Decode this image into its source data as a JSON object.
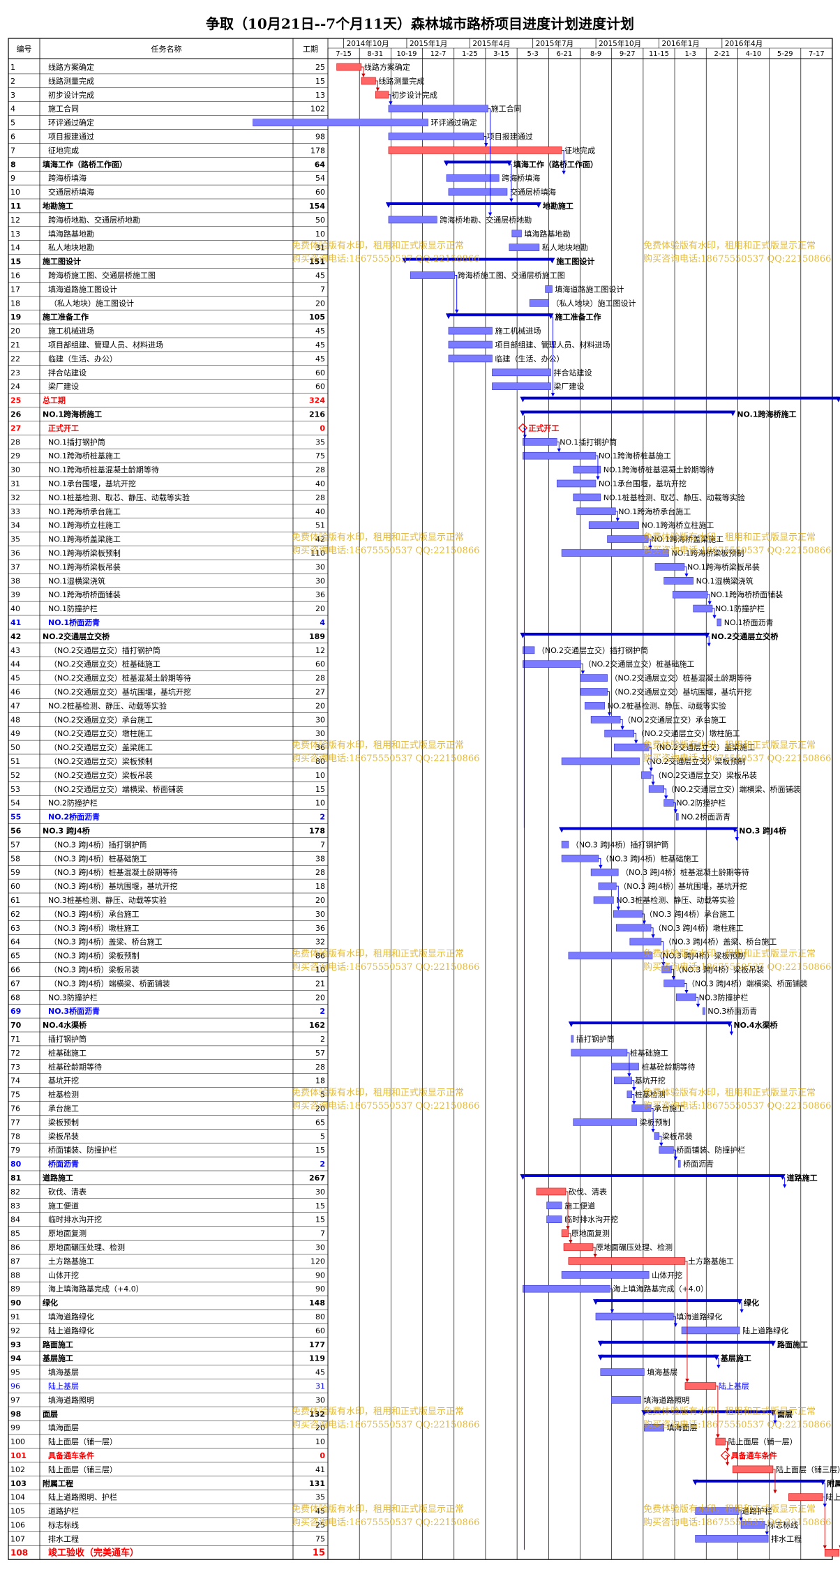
{
  "title": "争取（10月21日--7个月11天）森林城市路桥项目进度计划进度计划",
  "headers": {
    "id": "编号",
    "name": "任务名称",
    "duration": "工期"
  },
  "timescale": {
    "top": [
      "2014年10月",
      "2015年1月",
      "2015年4月",
      "2015年7月",
      "2015年10月",
      "2016年1月",
      "2016年4月"
    ],
    "bottom": [
      "7-15",
      "8-31",
      "10-19",
      "12-7",
      "1-25",
      "3-15",
      "5-3",
      "6-21",
      "8-9",
      "9-27",
      "11-15",
      "1-3",
      "2-21",
      "4-10",
      "5-29",
      "7-17"
    ]
  },
  "watermark": {
    "line1": "免费体验版有水印，租用和正式版显示正常",
    "line2": "购买咨询电话:18675550537 QQ:22150866"
  },
  "colors": {
    "normal_bar": "#7b7bff",
    "critical_bar": "#ff6666",
    "summary": "#0000cc",
    "critical_text": "#ff0000",
    "blue_text": "#0000ff",
    "link_normal": "#0000ff",
    "link_critical": "#cc0000"
  },
  "chart_data": {
    "type": "gantt",
    "x_unit": "week",
    "tasks": [
      {
        "id": 1,
        "name": "线路方案确定",
        "duration": 25,
        "start": 1.3,
        "end": 4.9,
        "style": "c"
      },
      {
        "id": 2,
        "name": "线路测量完成",
        "duration": 15,
        "start": 4.9,
        "end": 7.0,
        "style": "c"
      },
      {
        "id": 3,
        "name": "初步设计完成",
        "duration": 13,
        "start": 7.0,
        "end": 8.9,
        "style": "c"
      },
      {
        "id": 4,
        "name": "施工合同",
        "duration": 102,
        "start": 8.9,
        "end": 23.5,
        "style": "n"
      },
      {
        "id": 5,
        "name": "环评通过确定",
        "duration": 180,
        "start": -11.0,
        "end": 14.7,
        "style": "n"
      },
      {
        "id": 6,
        "name": "项目报建通过",
        "duration": 98,
        "start": 8.9,
        "end": 22.9,
        "style": "n"
      },
      {
        "id": 7,
        "name": "征地完成",
        "duration": 178,
        "start": 8.9,
        "end": 34.3,
        "style": "c"
      },
      {
        "id": 8,
        "name": "填海工作（路桥工作面）",
        "duration": 64,
        "start": 17.4,
        "end": 26.6,
        "style": "s"
      },
      {
        "id": 9,
        "name": "跨海桥填海",
        "duration": 54,
        "start": 17.4,
        "end": 25.1,
        "style": "n"
      },
      {
        "id": 10,
        "name": "交通层桥填海",
        "duration": 60,
        "start": 17.7,
        "end": 26.3,
        "style": "n"
      },
      {
        "id": 11,
        "name": "地勘施工",
        "duration": 154,
        "start": 8.9,
        "end": 30.9,
        "style": "s"
      },
      {
        "id": 12,
        "name": "跨海桥地勘、交通层桥地勘",
        "duration": 50,
        "start": 8.9,
        "end": 16.0,
        "style": "n"
      },
      {
        "id": 13,
        "name": "填海路基地勘",
        "duration": 10,
        "start": 27.0,
        "end": 28.4,
        "style": "n"
      },
      {
        "id": 14,
        "name": "私人地块地勘",
        "duration": 31,
        "start": 26.6,
        "end": 31.0,
        "style": "n"
      },
      {
        "id": 15,
        "name": "施工图设计",
        "duration": 151,
        "start": 11.3,
        "end": 32.9,
        "style": "s"
      },
      {
        "id": 16,
        "name": "跨海桥施工图、交通层桥施工图",
        "duration": 45,
        "start": 12.1,
        "end": 18.6,
        "style": "n"
      },
      {
        "id": 17,
        "name": "填海道路施工图设计",
        "duration": 7,
        "start": 31.9,
        "end": 32.9,
        "style": "n"
      },
      {
        "id": 18,
        "name": "（私人地块）施工图设计",
        "duration": 20,
        "start": 29.6,
        "end": 32.4,
        "style": "n"
      },
      {
        "id": 19,
        "name": "施工准备工作",
        "duration": 105,
        "start": 17.7,
        "end": 32.7,
        "style": "s"
      },
      {
        "id": 20,
        "name": "施工机械进场",
        "duration": 45,
        "start": 17.7,
        "end": 24.1,
        "style": "n"
      },
      {
        "id": 21,
        "name": "项目部组建、管理人员、材料进场",
        "duration": 45,
        "start": 17.7,
        "end": 24.1,
        "style": "n"
      },
      {
        "id": 22,
        "name": "临建（生活、办公）",
        "duration": 45,
        "start": 17.7,
        "end": 24.1,
        "style": "n"
      },
      {
        "id": 23,
        "name": "拌合站建设",
        "duration": 60,
        "start": 24.1,
        "end": 32.7,
        "style": "n"
      },
      {
        "id": 24,
        "name": "梁厂建设",
        "duration": 60,
        "start": 24.1,
        "end": 32.7,
        "style": "n"
      },
      {
        "id": 25,
        "name": "总工期",
        "duration": 324,
        "start": 28.6,
        "end": 74.9,
        "style": "cs"
      },
      {
        "id": 26,
        "name": "NO.1跨海桥施工",
        "duration": 216,
        "start": 28.6,
        "end": 59.4,
        "style": "s"
      },
      {
        "id": 27,
        "name": "正式开工",
        "duration": 0,
        "start": 28.6,
        "end": 28.6,
        "style": "m"
      },
      {
        "id": 28,
        "name": "NO.1插打钢护筒",
        "duration": 35,
        "start": 28.6,
        "end": 33.6,
        "style": "n"
      },
      {
        "id": 29,
        "name": "NO.1跨海桥桩基施工",
        "duration": 75,
        "start": 28.6,
        "end": 39.3,
        "style": "n"
      },
      {
        "id": 30,
        "name": "NO.1跨海桥桩基混凝土龄期等待",
        "duration": 28,
        "start": 36.0,
        "end": 40.0,
        "style": "n"
      },
      {
        "id": 31,
        "name": "NO.1承台围堰，基坑开挖",
        "duration": 40,
        "start": 33.6,
        "end": 39.3,
        "style": "n"
      },
      {
        "id": 32,
        "name": "NO.1桩基检测、取芯、静压、动载等实验",
        "duration": 28,
        "start": 36.0,
        "end": 40.0,
        "style": "n"
      },
      {
        "id": 33,
        "name": "NO.1跨海桥承台施工",
        "duration": 40,
        "start": 36.5,
        "end": 42.2,
        "style": "n"
      },
      {
        "id": 34,
        "name": "NO.1跨海桥立柱施工",
        "duration": 51,
        "start": 38.3,
        "end": 45.6,
        "style": "n"
      },
      {
        "id": 35,
        "name": "NO.1跨海桥盖梁施工",
        "duration": 42,
        "start": 41.0,
        "end": 47.0,
        "style": "n"
      },
      {
        "id": 36,
        "name": "NO.1跨海桥梁板预制",
        "duration": 110,
        "start": 34.3,
        "end": 50.0,
        "style": "n"
      },
      {
        "id": 37,
        "name": "NO.1跨海桥梁板吊装",
        "duration": 30,
        "start": 48.0,
        "end": 52.3,
        "style": "n"
      },
      {
        "id": 38,
        "name": "NO.1湿横梁浇筑",
        "duration": 30,
        "start": 49.3,
        "end": 53.6,
        "style": "n"
      },
      {
        "id": 39,
        "name": "NO.1跨海桥桥面铺装",
        "duration": 36,
        "start": 50.6,
        "end": 55.7,
        "style": "n"
      },
      {
        "id": 40,
        "name": "NO.1防撞护栏",
        "duration": 20,
        "start": 53.6,
        "end": 56.4,
        "style": "n"
      },
      {
        "id": 41,
        "name": "NO.1桥面沥青",
        "duration": 4,
        "start": 57.1,
        "end": 57.7,
        "style": "n"
      },
      {
        "id": 42,
        "name": "NO.2交通层立交桥",
        "duration": 189,
        "start": 28.6,
        "end": 55.6,
        "style": "s"
      },
      {
        "id": 43,
        "name": "（NO.2交通层立交）插打钢护筒",
        "duration": 12,
        "start": 28.6,
        "end": 30.3,
        "style": "n"
      },
      {
        "id": 44,
        "name": "（NO.2交通层立交）桩基础施工",
        "duration": 60,
        "start": 28.6,
        "end": 37.1,
        "style": "n"
      },
      {
        "id": 45,
        "name": "（NO.2交通层立交）桩基混凝土龄期等待",
        "duration": 28,
        "start": 37.0,
        "end": 41.0,
        "style": "n"
      },
      {
        "id": 46,
        "name": "（NO.2交通层立交）基坑围堰，基坑开挖",
        "duration": 27,
        "start": 37.1,
        "end": 41.0,
        "style": "n"
      },
      {
        "id": 47,
        "name": "NO.2桩基检测、静压、动载等实验",
        "duration": 20,
        "start": 37.7,
        "end": 40.6,
        "style": "n"
      },
      {
        "id": 48,
        "name": "（NO.2交通层立交）承台施工",
        "duration": 30,
        "start": 38.6,
        "end": 42.9,
        "style": "n"
      },
      {
        "id": 49,
        "name": "（NO.2交通层立交）墩柱施工",
        "duration": 30,
        "start": 40.6,
        "end": 44.9,
        "style": "n"
      },
      {
        "id": 50,
        "name": "（NO.2交通层立交）盖梁施工",
        "duration": 36,
        "start": 42.0,
        "end": 47.1,
        "style": "n"
      },
      {
        "id": 51,
        "name": "（NO.2交通层立交）梁板预制",
        "duration": 80,
        "start": 34.3,
        "end": 45.7,
        "style": "n"
      },
      {
        "id": 52,
        "name": "（NO.2交通层立交）梁板吊装",
        "duration": 10,
        "start": 46.0,
        "end": 47.4,
        "style": "n"
      },
      {
        "id": 53,
        "name": "（NO.2交通层立交）端横梁、桥面铺装",
        "duration": 15,
        "start": 47.1,
        "end": 49.3,
        "style": "n"
      },
      {
        "id": 54,
        "name": "NO.2防撞护栏",
        "duration": 10,
        "start": 49.3,
        "end": 50.7,
        "style": "n"
      },
      {
        "id": 55,
        "name": "NO.2桥面沥青",
        "duration": 2,
        "start": 51.1,
        "end": 51.4,
        "style": "n"
      },
      {
        "id": 56,
        "name": "NO.3 跨J4桥",
        "duration": 178,
        "start": 34.3,
        "end": 59.7,
        "style": "s"
      },
      {
        "id": 57,
        "name": "（NO.3 跨J4桥）插打钢护筒",
        "duration": 7,
        "start": 34.3,
        "end": 35.3,
        "style": "n"
      },
      {
        "id": 58,
        "name": "（NO.3 跨J4桥）桩基础施工",
        "duration": 38,
        "start": 34.3,
        "end": 39.7,
        "style": "n"
      },
      {
        "id": 59,
        "name": "（NO.3 跨J4桥）桩基混凝土龄期等待",
        "duration": 28,
        "start": 38.6,
        "end": 42.6,
        "style": "n"
      },
      {
        "id": 60,
        "name": "（NO.3 跨J4桥）基坑围堰，基坑开挖",
        "duration": 18,
        "start": 39.7,
        "end": 42.3,
        "style": "n"
      },
      {
        "id": 61,
        "name": "NO.3桩基检测、静压、动载等实验",
        "duration": 20,
        "start": 39.0,
        "end": 41.9,
        "style": "n"
      },
      {
        "id": 62,
        "name": "（NO.3 跨J4桥）承台施工",
        "duration": 30,
        "start": 41.9,
        "end": 46.1,
        "style": "n"
      },
      {
        "id": 63,
        "name": "（NO.3 跨J4桥）墩柱施工",
        "duration": 36,
        "start": 42.3,
        "end": 47.4,
        "style": "n"
      },
      {
        "id": 64,
        "name": "（NO.3 跨J4桥）盖梁、桥台施工",
        "duration": 32,
        "start": 44.3,
        "end": 48.9,
        "style": "n"
      },
      {
        "id": 65,
        "name": "（NO.3 跨J4桥）梁板预制",
        "duration": 86,
        "start": 35.3,
        "end": 47.6,
        "style": "n"
      },
      {
        "id": 66,
        "name": "（NO.3 跨J4桥）梁板吊装",
        "duration": 10,
        "start": 49.0,
        "end": 50.4,
        "style": "n"
      },
      {
        "id": 67,
        "name": "（NO.3 跨J4桥）端横梁、桥面铺装",
        "duration": 21,
        "start": 49.3,
        "end": 52.3,
        "style": "n"
      },
      {
        "id": 68,
        "name": "NO.3防撞护栏",
        "duration": 20,
        "start": 51.1,
        "end": 54.0,
        "style": "n"
      },
      {
        "id": 69,
        "name": "NO.3桥面沥青",
        "duration": 2,
        "start": 55.0,
        "end": 55.3,
        "style": "n"
      },
      {
        "id": 70,
        "name": "NO.4水渠桥",
        "duration": 162,
        "start": 35.7,
        "end": 58.9,
        "style": "s"
      },
      {
        "id": 71,
        "name": "插打钢护筒",
        "duration": 2,
        "start": 35.7,
        "end": 36.0,
        "style": "n"
      },
      {
        "id": 72,
        "name": "桩基础施工",
        "duration": 57,
        "start": 35.7,
        "end": 43.9,
        "style": "n"
      },
      {
        "id": 73,
        "name": "桩基砼龄期等待",
        "duration": 28,
        "start": 41.6,
        "end": 45.6,
        "style": "n"
      },
      {
        "id": 74,
        "name": "基坑开挖",
        "duration": 18,
        "start": 42.0,
        "end": 44.6,
        "style": "n"
      },
      {
        "id": 75,
        "name": "桩基检测",
        "duration": 5,
        "start": 43.9,
        "end": 44.6,
        "style": "n"
      },
      {
        "id": 76,
        "name": "承台施工",
        "duration": 20,
        "start": 44.6,
        "end": 47.4,
        "style": "n"
      },
      {
        "id": 77,
        "name": "梁板预制",
        "duration": 65,
        "start": 36.0,
        "end": 45.3,
        "style": "n"
      },
      {
        "id": 78,
        "name": "梁板吊装",
        "duration": 5,
        "start": 47.9,
        "end": 48.6,
        "style": "n"
      },
      {
        "id": 79,
        "name": "桥面铺装、防撞护栏",
        "duration": 15,
        "start": 48.6,
        "end": 50.7,
        "style": "n"
      },
      {
        "id": 80,
        "name": "桥面沥青",
        "duration": 2,
        "start": 51.4,
        "end": 51.7,
        "style": "n"
      },
      {
        "id": 81,
        "name": "道路施工",
        "duration": 267,
        "start": 28.6,
        "end": 66.7,
        "style": "s"
      },
      {
        "id": 82,
        "name": "砍伐、清表",
        "duration": 30,
        "start": 30.6,
        "end": 34.9,
        "style": "c"
      },
      {
        "id": 83,
        "name": "施工便道",
        "duration": 15,
        "start": 32.1,
        "end": 34.3,
        "style": "n"
      },
      {
        "id": 84,
        "name": "临时排水沟开挖",
        "duration": 15,
        "start": 32.1,
        "end": 34.3,
        "style": "n"
      },
      {
        "id": 85,
        "name": "原地面复测",
        "duration": 7,
        "start": 34.3,
        "end": 35.3,
        "style": "c"
      },
      {
        "id": 86,
        "name": "原地面碾压处理、检测",
        "duration": 30,
        "start": 34.6,
        "end": 38.9,
        "style": "c"
      },
      {
        "id": 87,
        "name": "土方路基施工",
        "duration": 120,
        "start": 35.3,
        "end": 52.4,
        "style": "c"
      },
      {
        "id": 88,
        "name": "山体开挖",
        "duration": 90,
        "start": 34.3,
        "end": 47.1,
        "style": "n"
      },
      {
        "id": 89,
        "name": "海上填海路基完成（+4.0）",
        "duration": 90,
        "start": 28.6,
        "end": 41.4,
        "style": "n"
      },
      {
        "id": 90,
        "name": "绿化",
        "duration": 148,
        "start": 39.3,
        "end": 60.4,
        "style": "s"
      },
      {
        "id": 91,
        "name": "填海道路绿化",
        "duration": 80,
        "start": 39.3,
        "end": 50.7,
        "style": "n"
      },
      {
        "id": 92,
        "name": "陆上道路绿化",
        "duration": 60,
        "start": 51.9,
        "end": 60.4,
        "style": "n"
      },
      {
        "id": 93,
        "name": "路面施工",
        "duration": 177,
        "start": 40.0,
        "end": 65.3,
        "style": "s"
      },
      {
        "id": 94,
        "name": "基层施工",
        "duration": 119,
        "start": 40.0,
        "end": 57.0,
        "style": "s"
      },
      {
        "id": 95,
        "name": "填海基层",
        "duration": 45,
        "start": 40.0,
        "end": 46.4,
        "style": "n"
      },
      {
        "id": 96,
        "name": "陆上基层",
        "duration": 31,
        "start": 52.4,
        "end": 56.9,
        "style": "c"
      },
      {
        "id": 97,
        "name": "填海道路照明",
        "duration": 30,
        "start": 41.6,
        "end": 45.9,
        "style": "n"
      },
      {
        "id": 98,
        "name": "面层",
        "duration": 132,
        "start": 46.4,
        "end": 65.3,
        "style": "s"
      },
      {
        "id": 99,
        "name": "填海面层",
        "duration": 20,
        "start": 46.4,
        "end": 49.3,
        "style": "n"
      },
      {
        "id": 100,
        "name": "陆上面层（铺一层）",
        "duration": 10,
        "start": 56.9,
        "end": 58.3,
        "style": "c"
      },
      {
        "id": 101,
        "name": "具备通车条件",
        "duration": 0,
        "start": 58.3,
        "end": 58.3,
        "style": "m"
      },
      {
        "id": 102,
        "name": "陆上面层（铺三层）",
        "duration": 41,
        "start": 59.4,
        "end": 65.3,
        "style": "c"
      },
      {
        "id": 103,
        "name": "附属工程",
        "duration": 131,
        "start": 53.9,
        "end": 72.6,
        "style": "s"
      },
      {
        "id": 104,
        "name": "陆上道路照明、护栏",
        "duration": 35,
        "start": 67.6,
        "end": 72.6,
        "style": "c"
      },
      {
        "id": 105,
        "name": "道路护栏",
        "duration": 45,
        "start": 53.9,
        "end": 60.3,
        "style": "n"
      },
      {
        "id": 106,
        "name": "标志标线",
        "duration": 25,
        "start": 60.6,
        "end": 64.1,
        "style": "n"
      },
      {
        "id": 107,
        "name": "排水工程",
        "duration": 75,
        "start": 53.9,
        "end": 64.6,
        "style": "n"
      },
      {
        "id": 108,
        "name": "竣工验收（完美通车）",
        "duration": 15,
        "start": 72.9,
        "end": 75.0,
        "style": "c"
      }
    ],
    "links": [
      [
        1,
        2
      ],
      [
        2,
        3
      ],
      [
        3,
        4
      ],
      [
        4,
        12
      ],
      [
        6,
        7
      ],
      [
        7,
        9
      ],
      [
        8,
        11
      ],
      [
        16,
        19
      ],
      [
        19,
        25
      ],
      [
        27,
        28
      ],
      [
        28,
        29
      ],
      [
        29,
        31
      ],
      [
        33,
        34
      ],
      [
        35,
        36
      ],
      [
        37,
        38
      ],
      [
        39,
        40
      ],
      [
        40,
        41
      ],
      [
        42,
        43
      ],
      [
        44,
        45
      ],
      [
        46,
        48
      ],
      [
        48,
        49
      ],
      [
        49,
        50
      ],
      [
        50,
        52
      ],
      [
        52,
        53
      ],
      [
        53,
        54
      ],
      [
        54,
        55
      ],
      [
        56,
        57
      ],
      [
        58,
        59
      ],
      [
        60,
        62
      ],
      [
        62,
        63
      ],
      [
        63,
        64
      ],
      [
        64,
        66
      ],
      [
        66,
        67
      ],
      [
        67,
        68
      ],
      [
        68,
        69
      ],
      [
        70,
        71
      ],
      [
        72,
        74
      ],
      [
        74,
        75
      ],
      [
        75,
        76
      ],
      [
        76,
        78
      ],
      [
        78,
        79
      ],
      [
        79,
        80
      ],
      [
        81,
        82
      ],
      [
        82,
        85
      ],
      [
        85,
        86
      ],
      [
        86,
        87
      ],
      [
        87,
        96
      ],
      [
        96,
        100
      ],
      [
        100,
        101
      ],
      [
        101,
        102
      ],
      [
        102,
        104
      ],
      [
        104,
        108
      ],
      [
        90,
        91
      ],
      [
        91,
        92
      ],
      [
        94,
        95
      ],
      [
        98,
        99
      ],
      [
        103,
        105
      ],
      [
        105,
        106
      ],
      [
        106,
        107
      ],
      [
        25,
        108
      ],
      [
        89,
        91
      ]
    ]
  }
}
